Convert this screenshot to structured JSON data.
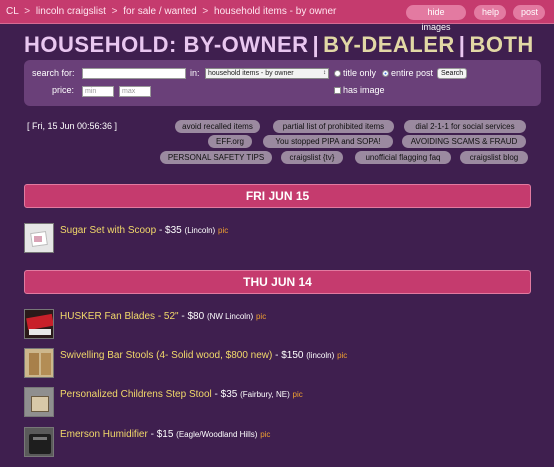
{
  "breadcrumb": {
    "items": [
      "CL",
      "lincoln craigslist",
      "for sale / wanted",
      "household items - by owner"
    ],
    "separator": ">"
  },
  "top_buttons": [
    "hide images",
    "help",
    "post"
  ],
  "heading": {
    "owner": "HOUSEHOLD: BY-OWNER",
    "sep1": "|",
    "dealer": "BY-DEALER",
    "sep2": "|",
    "both": "BOTH"
  },
  "search": {
    "search_label": "search for:",
    "in_label": "in:",
    "category": "household items - by owner",
    "title_only": "title only",
    "entire_post": "entire post",
    "button": "Search",
    "price_label": "price:",
    "min_placeholder": "min",
    "max_placeholder": "max",
    "has_image": "has image"
  },
  "datetime": "[ Fri, 15 Jun 00:56:36 ]",
  "links": [
    "avoid recalled items",
    "partial list of prohibited items",
    "dial 2-1-1 for social services",
    "EFF.org",
    "You stopped PIPA and SOPA!",
    "AVOIDING SCAMS & FRAUD",
    "PERSONAL SAFETY TIPS",
    "craigslist {tv}",
    "unofficial flagging faq",
    "craigslist blog"
  ],
  "days": [
    {
      "label": "FRI JUN 15",
      "listings": [
        {
          "title": "Sugar Set with Scoop",
          "price": "- $35",
          "location": "(Lincoln)",
          "pic": "pic"
        }
      ]
    },
    {
      "label": "THU JUN 14",
      "listings": [
        {
          "title": "HUSKER Fan Blades - 52\"",
          "price": "- $80",
          "location": "(NW Lincoln)",
          "pic": "pic"
        },
        {
          "title": "Swivelling Bar Stools (4- Solid wood, $800 new)",
          "price": "- $150",
          "location": "(lincoln)",
          "pic": "pic"
        },
        {
          "title": "Personalized Childrens Step Stool",
          "price": "- $35",
          "location": "(Fairbury, NE)",
          "pic": "pic"
        },
        {
          "title": "Emerson Humidifier",
          "price": "- $15",
          "location": "(Eagle/Woodland Hills)",
          "pic": "pic"
        }
      ]
    }
  ]
}
